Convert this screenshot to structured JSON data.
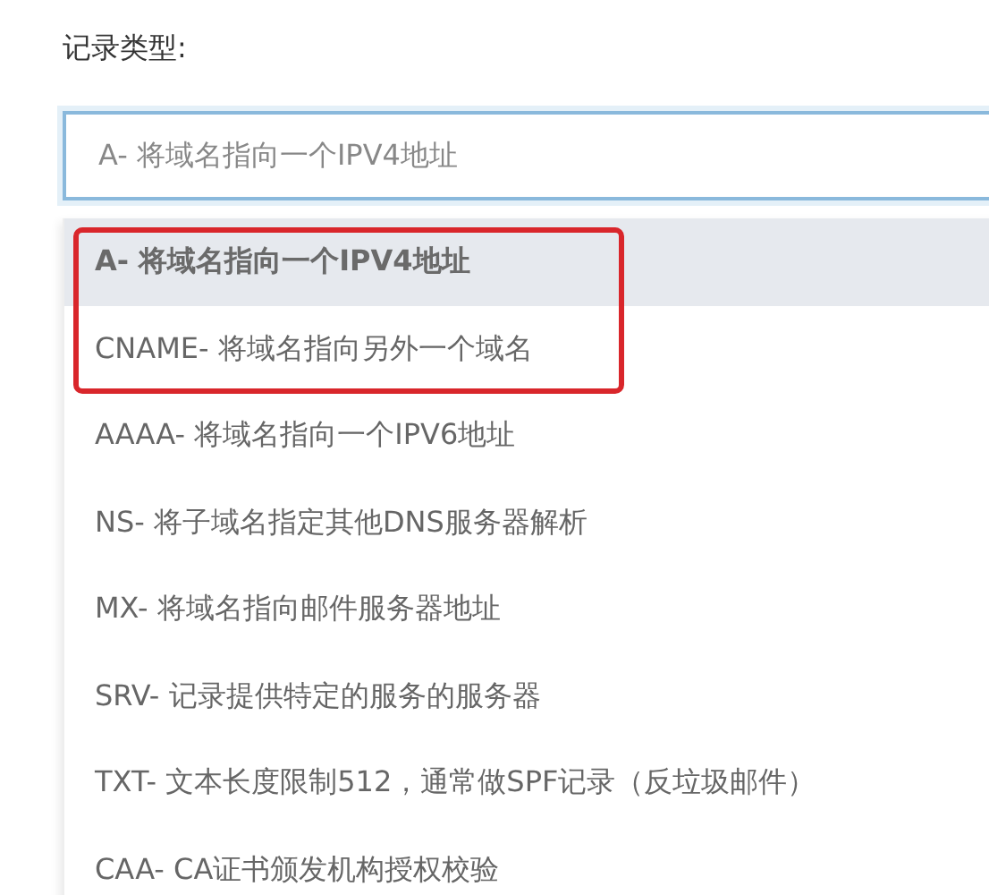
{
  "field": {
    "label": "记录类型:",
    "value": "A- 将域名指向一个IPV4地址"
  },
  "options": [
    {
      "text": "A- 将域名指向一个IPV4地址",
      "selected": true,
      "highlighted": true
    },
    {
      "text": "CNAME- 将域名指向另外一个域名",
      "selected": false,
      "highlighted": true
    },
    {
      "text": "AAAA- 将域名指向一个IPV6地址",
      "selected": false,
      "highlighted": false
    },
    {
      "text": "NS- 将子域名指定其他DNS服务器解析",
      "selected": false,
      "highlighted": false
    },
    {
      "text": "MX- 将域名指向邮件服务器地址",
      "selected": false,
      "highlighted": false
    },
    {
      "text": "SRV- 记录提供特定的服务的服务器",
      "selected": false,
      "highlighted": false
    },
    {
      "text": "TXT- 文本长度限制512，通常做SPF记录（反垃圾邮件）",
      "selected": false,
      "highlighted": false
    },
    {
      "text": "CAA- CA证书颁发机构授权校验",
      "selected": false,
      "highlighted": false
    }
  ]
}
